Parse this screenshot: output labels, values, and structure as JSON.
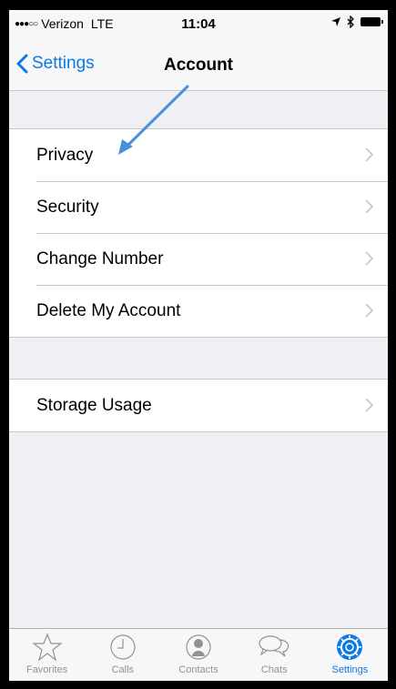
{
  "status": {
    "carrier": "Verizon",
    "network": "LTE",
    "time": "11:04"
  },
  "nav": {
    "back_label": "Settings",
    "title": "Account"
  },
  "groups": [
    {
      "items": [
        {
          "label": "Privacy"
        },
        {
          "label": "Security"
        },
        {
          "label": "Change Number"
        },
        {
          "label": "Delete My Account"
        }
      ]
    },
    {
      "items": [
        {
          "label": "Storage Usage"
        }
      ]
    }
  ],
  "tabs": [
    {
      "label": "Favorites",
      "icon": "star-icon"
    },
    {
      "label": "Calls",
      "icon": "clock-icon"
    },
    {
      "label": "Contacts",
      "icon": "contact-icon"
    },
    {
      "label": "Chats",
      "icon": "chat-bubbles-icon"
    },
    {
      "label": "Settings",
      "icon": "gear-icon",
      "active": true
    }
  ],
  "colors": {
    "accent": "#0a7ae6",
    "annotation_arrow": "#4a90d9"
  }
}
